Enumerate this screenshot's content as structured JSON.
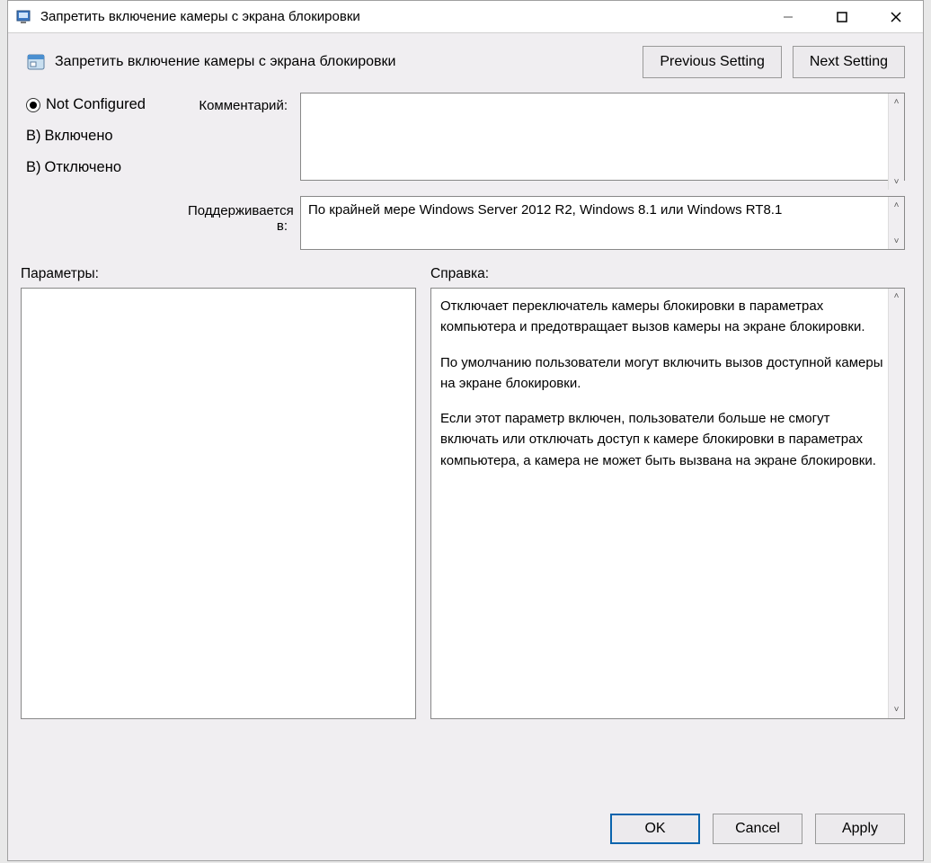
{
  "window": {
    "title": "Запретить включение камеры с экрана блокировки"
  },
  "header": {
    "title": "Запретить включение камеры с экрана блокировки",
    "previous_button": "Previous Setting",
    "next_button": "Next Setting"
  },
  "config": {
    "radios": {
      "not_configured": "Not Configured",
      "enabled_prefix": "B)",
      "enabled_label": "Включено",
      "disabled_prefix": "B)",
      "disabled_label": "Отключено"
    },
    "comment_label": "Комментарий:",
    "comment_value": "",
    "supported_label": "Поддерживается в:",
    "supported_value": "По крайней мере Windows Server 2012 R2, Windows 8.1 или Windows RT8.1"
  },
  "mid": {
    "params_label": "Параметры:",
    "help_label": "Справка:",
    "help_text_p1": "Отключает переключатель камеры блокировки в параметрах компьютера и предотвращает вызов камеры на экране блокировки.",
    "help_text_p2": "По умолчанию пользователи могут включить вызов доступной камеры на экране блокировки.",
    "help_text_p3": "Если этот параметр включен, пользователи больше не смогут включать или отключать доступ к камере блокировки в параметрах компьютера, а камера не может быть вызвана на экране блокировки."
  },
  "buttons": {
    "ok": "OK",
    "cancel": "Cancel",
    "apply": "Apply"
  }
}
